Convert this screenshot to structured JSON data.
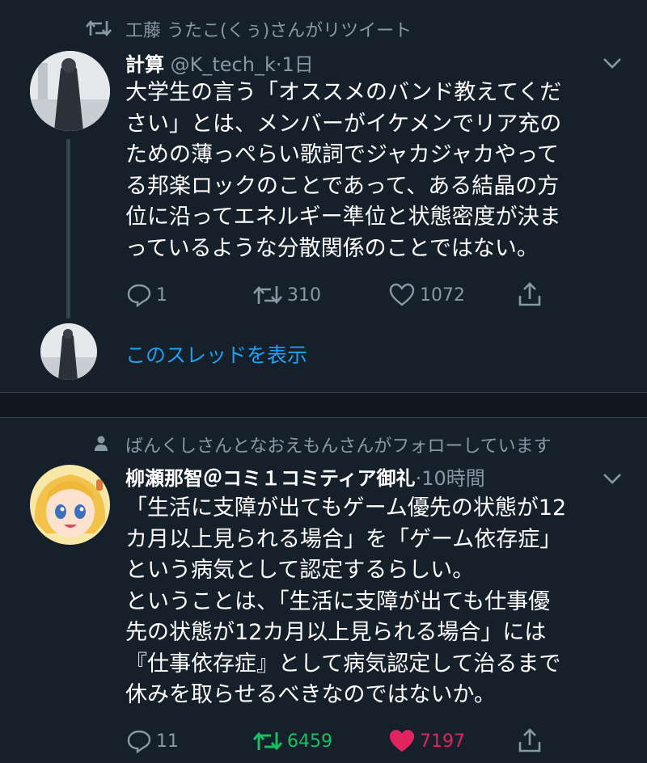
{
  "colors": {
    "background": "#15202b",
    "muted": "#8899a6",
    "link": "#1da1f2",
    "retweet_active": "#17bf63",
    "like_active": "#e0245e"
  },
  "tweet1": {
    "context_text": "工藤 うたこ(くぅ)さんがリツイート",
    "context_icon": "retweet-icon",
    "name": "計算",
    "handle": "@K_tech_k",
    "separator": "·",
    "time": "1日",
    "text": "大学生の言う「オススメのバンド教えてくだ\nさい」とは、メンバーがイケメンでリア充の\nための薄っぺらい歌詞でジャカジャカやって\nる邦楽ロックのことであって、ある結晶の方\n位に沿ってエネルギー準位と状態密度が決ま\nっているような分散関係のことではない。",
    "replies": "1",
    "retweets": "310",
    "likes": "1072",
    "show_thread": "このスレッドを表示"
  },
  "tweet2": {
    "context_text": "ばんくしさんとなおえもんさんがフォローしています",
    "context_icon": "person-icon",
    "name": "柳瀬那智＠コミ１コミティア御礼",
    "separator": "·",
    "time": "10時間",
    "text": "「生活に支障が出てもゲーム優先の状態が12\nカ月以上見られる場合」を「ゲーム依存症」\nという病気として認定するらしい。\nということは、「生活に支障が出ても仕事優\n先の状態が12カ月以上見られる場合」には\n『仕事依存症』として病気認定して治るまで\n休みを取らせるべきなのではないか。",
    "replies": "11",
    "retweets": "6459",
    "likes": "7197"
  }
}
